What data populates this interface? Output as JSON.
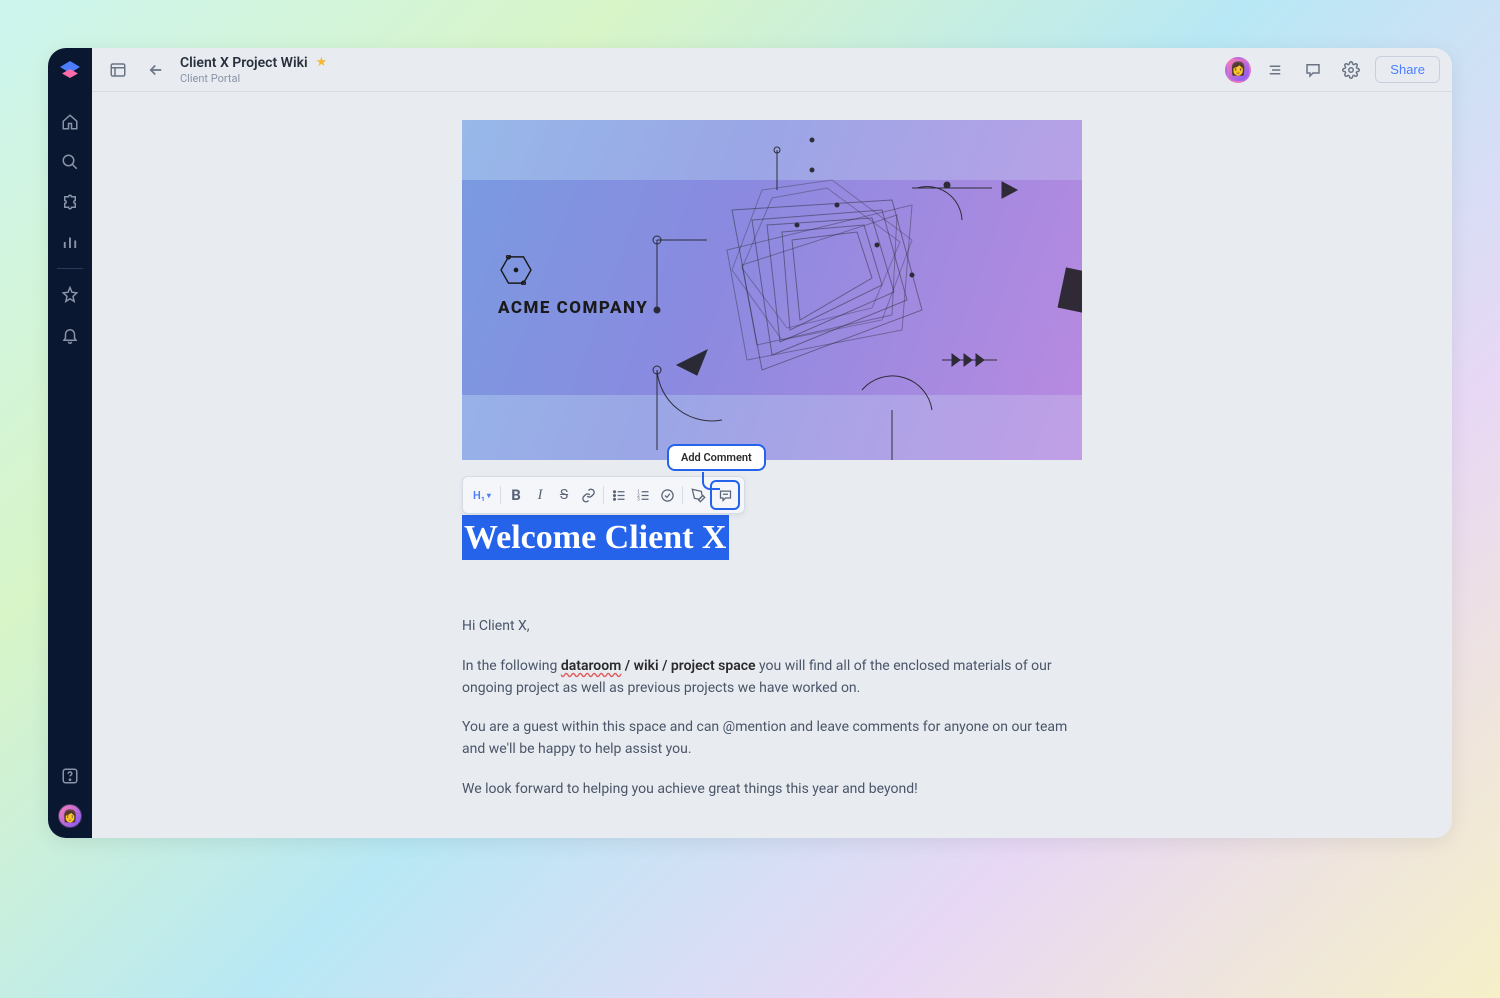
{
  "header": {
    "page_title": "Client X Project Wiki",
    "breadcrumb": "Client Portal",
    "share_label": "Share"
  },
  "cover": {
    "company_label": "ACME COMPANY"
  },
  "toolbar": {
    "heading_label": "H₁",
    "tooltip": "Add Comment"
  },
  "document": {
    "heading": "Welcome Client X",
    "p1": "Hi Client X,",
    "p2_lead": "In the following ",
    "p2_err": "dataroom",
    "p2_bold": " / wiki / project space",
    "p2_tail": " you will find all of the enclosed materials of our ongoing project as well as previous projects we have worked on.",
    "p3": "You are a guest within this space and can @mention and leave comments for anyone on our team and we'll be happy to help assist you.",
    "p4": "We look forward to helping you achieve great things this year and beyond!"
  }
}
